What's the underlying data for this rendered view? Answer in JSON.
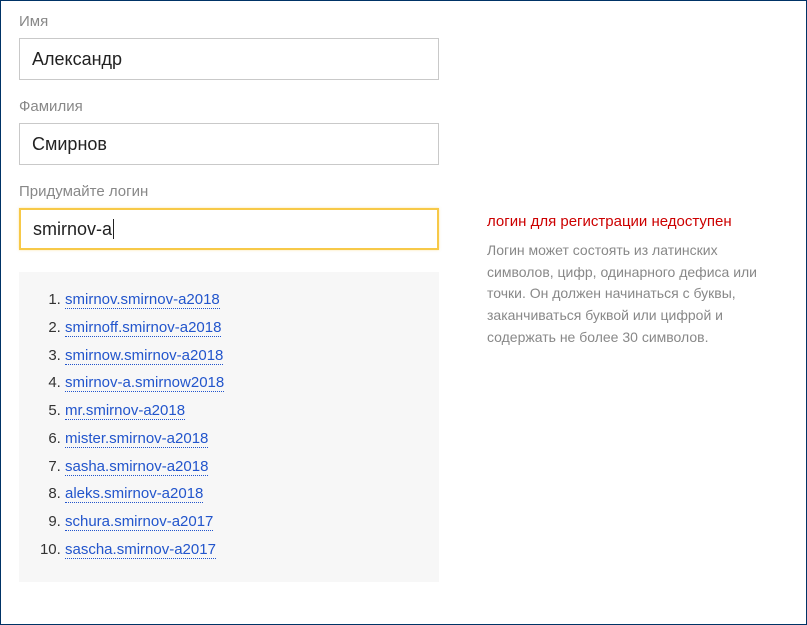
{
  "form": {
    "firstName": {
      "label": "Имя",
      "value": "Александр"
    },
    "lastName": {
      "label": "Фамилия",
      "value": "Смирнов"
    },
    "login": {
      "label": "Придумайте логин",
      "value": "smirnov-a"
    }
  },
  "validation": {
    "error": "логин для регистрации недоступен",
    "hint": "Логин может состоять из латинских символов, цифр, одинарного дефиса или точки. Он должен начинаться с буквы, заканчиваться буквой или цифрой и содержать не более 30 символов."
  },
  "suggestions": [
    "smirnov.smirnov-a2018",
    "smirnoff.smirnov-a2018",
    "smirnow.smirnov-a2018",
    "smirnov-a.smirnow2018",
    "mr.smirnov-a2018",
    "mister.smirnov-a2018",
    "sasha.smirnov-a2018",
    "aleks.smirnov-a2018",
    "schura.smirnov-a2017",
    "sascha.smirnov-a2017"
  ]
}
